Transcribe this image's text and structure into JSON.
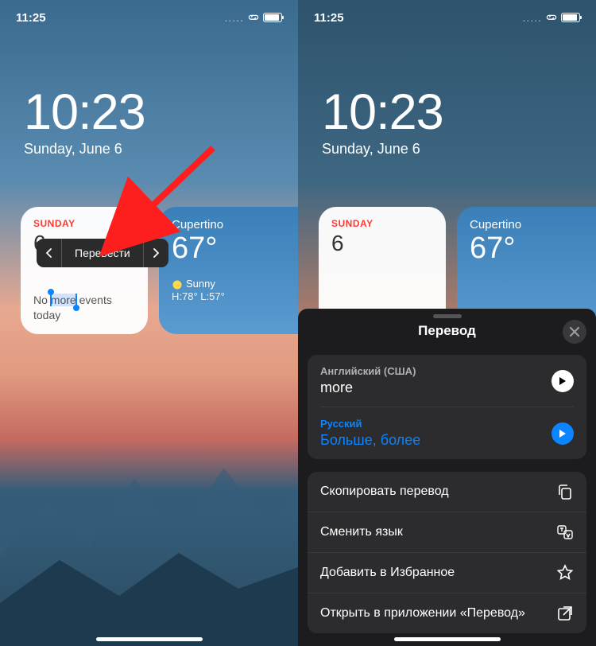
{
  "status": {
    "time": "11:25",
    "dots": "....."
  },
  "lockscreen": {
    "time": "10:23",
    "date": "Sunday, June 6"
  },
  "calendar": {
    "weekday": "SUNDAY",
    "day": "6",
    "event_pre": "No ",
    "event_sel": "more",
    "event_post": " events today"
  },
  "weather": {
    "city": "Cupertino",
    "temp": "67°",
    "condition": "Sunny",
    "hilo": "H:78° L:57°"
  },
  "popover": {
    "label": "Перевести"
  },
  "sheet": {
    "title": "Перевод",
    "source_lang": "Английский (США)",
    "source_text": "more",
    "target_lang": "Русский",
    "target_text": "Больше, более",
    "actions": {
      "copy": "Скопировать перевод",
      "switch": "Сменить язык",
      "favorite": "Добавить в Избранное",
      "open_app": "Открыть в приложении «Перевод»"
    }
  }
}
